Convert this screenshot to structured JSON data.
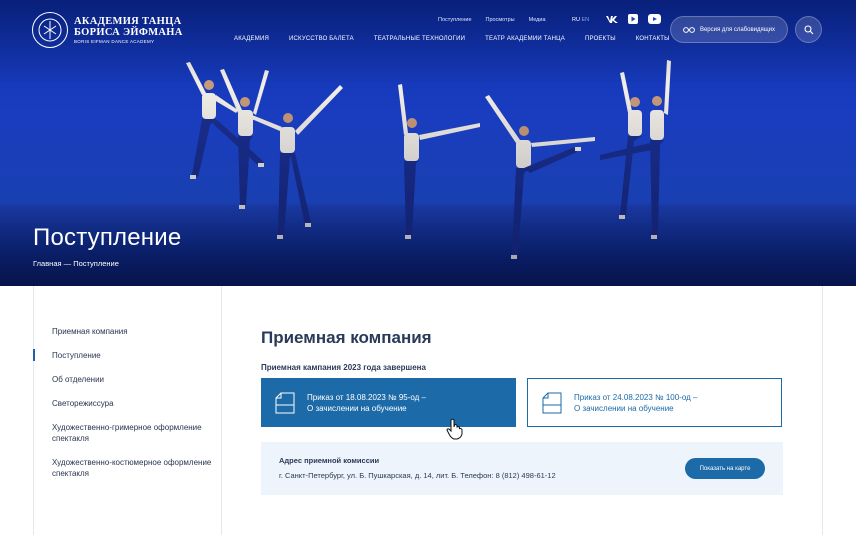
{
  "header": {
    "logo": {
      "line1": "АКАДЕМИЯ ТАНЦА",
      "line2": "БОРИСА ЭЙФМАНА",
      "line3": "BORIS EIFMAN DANCE ACADEMY"
    },
    "top_links": [
      "Поступление",
      "Просмотры",
      "Медиа"
    ],
    "lang": {
      "active": "RU",
      "other": "EN"
    },
    "social_icons": [
      "vk-icon",
      "rutube-icon",
      "youtube-icon"
    ],
    "nav": [
      "АКАДЕМИЯ",
      "ИСКУССТВО БАЛЕТА",
      "ТЕАТРАЛЬНЫЕ ТЕХНОЛОГИИ",
      "ТЕАТР АКАДЕМИИ ТАНЦА",
      "ПРОЕКТЫ",
      "КОНТАКТЫ"
    ],
    "a11y_label": "Версия для слабовидящих"
  },
  "hero": {
    "title": "Поступление",
    "breadcrumb": "Главная — Поступление"
  },
  "sidebar": {
    "items": [
      {
        "label": "Приемная компания"
      },
      {
        "label": "Поступление"
      },
      {
        "label": "Об отделении"
      },
      {
        "label": "Светорежиссура"
      },
      {
        "label": "Художественно-гримерное оформление спектакля"
      },
      {
        "label": "Художественно-костюмерное оформление спектакля"
      }
    ]
  },
  "main": {
    "title": "Приемная компания",
    "subtitle": "Приемная кампания 2023 года завершена",
    "cards": [
      {
        "line1": "Приказ от 18.08.2023 № 95-од –",
        "line2": "О зачислении на обучение"
      },
      {
        "line1": "Приказ от 24.08.2023 № 100-од –",
        "line2": "О зачислении на обучение"
      }
    ],
    "address": {
      "title": "Адрес приемной комиссии",
      "value": "г. Санкт-Петербург, ул. Б. Пушкарская, д. 14, лит. Б. Телефон: 8 (812) 498-61-12",
      "button": "Показать на карте"
    }
  },
  "colors": {
    "accent": "#1c6aa8",
    "hero_blue": "#1b3fc7"
  }
}
